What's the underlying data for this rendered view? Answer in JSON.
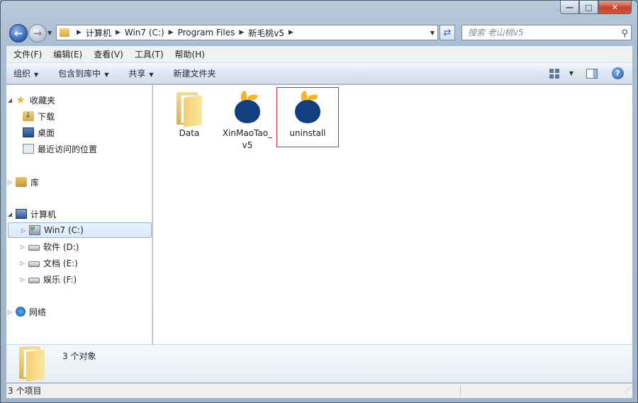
{
  "address": {
    "crumbs": [
      "计算机",
      "Win7 (C:)",
      "Program Files",
      "新毛桃v5"
    ]
  },
  "search": {
    "placeholder": "搜索 老山桃v5"
  },
  "menubar": {
    "items": [
      "文件(F)",
      "编辑(E)",
      "查看(V)",
      "工具(T)",
      "帮助(H)"
    ]
  },
  "commandbar": {
    "organize": "组织",
    "include": "包含到库中",
    "share": "共享",
    "new_folder": "新建文件夹"
  },
  "navpane": {
    "favorites": "收藏夹",
    "downloads": "下载",
    "desktop": "桌面",
    "recent": "最近访问的位置",
    "libraries": "库",
    "computer": "计算机",
    "drive_c": "Win7 (C:)",
    "drive_d": "软件 (D:)",
    "drive_e": "文档 (E:)",
    "drive_f": "娱乐 (F:)",
    "network": "网络"
  },
  "files": [
    {
      "name": "Data",
      "type": "folder"
    },
    {
      "name": "XinMaoTao_v5",
      "type": "app"
    },
    {
      "name": "uninstall",
      "type": "app",
      "selected": true
    }
  ],
  "details": {
    "summary": "3 个对象"
  },
  "statusbar": {
    "count": "3 个项目"
  },
  "colors": {
    "selection_border": "#d02a2a",
    "app_icon_blue": "#123f7f",
    "app_icon_leaf": "#f4b622"
  }
}
